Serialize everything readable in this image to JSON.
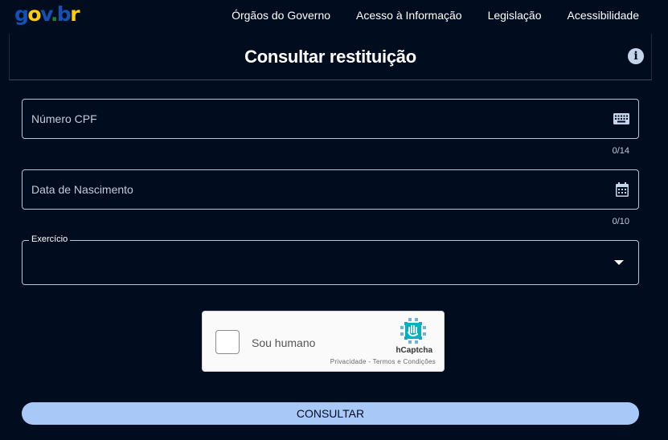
{
  "header": {
    "logo": {
      "g": "g",
      "o": "o",
      "v": "v",
      "dot": ".",
      "b": "b",
      "r": "r"
    },
    "nav": [
      "Órgãos do Governo",
      "Acesso à Informação",
      "Legislação",
      "Acessibilidade"
    ]
  },
  "page": {
    "title": "Consultar restituição",
    "info_icon": "i"
  },
  "form": {
    "cpf": {
      "placeholder": "Número CPF",
      "value": "",
      "counter": "0/14",
      "icon": "keyboard-icon"
    },
    "birth_date": {
      "placeholder": "Data de Nascimento",
      "value": "",
      "counter": "0/10",
      "icon": "calendar-icon"
    },
    "exercise": {
      "label": "Exercício",
      "value": "",
      "icon": "caret-down-icon"
    },
    "submit_label": "CONSULTAR"
  },
  "captcha": {
    "label": "Sou humano",
    "brand": "hCaptcha",
    "links": "Privacidade - Termos e Condições"
  },
  "colors": {
    "background": "#020c1f",
    "accent": "#a8c8f7",
    "govbr_blue": "#1351b4",
    "govbr_yellow": "#ffcd07",
    "govbr_green": "#168821"
  }
}
